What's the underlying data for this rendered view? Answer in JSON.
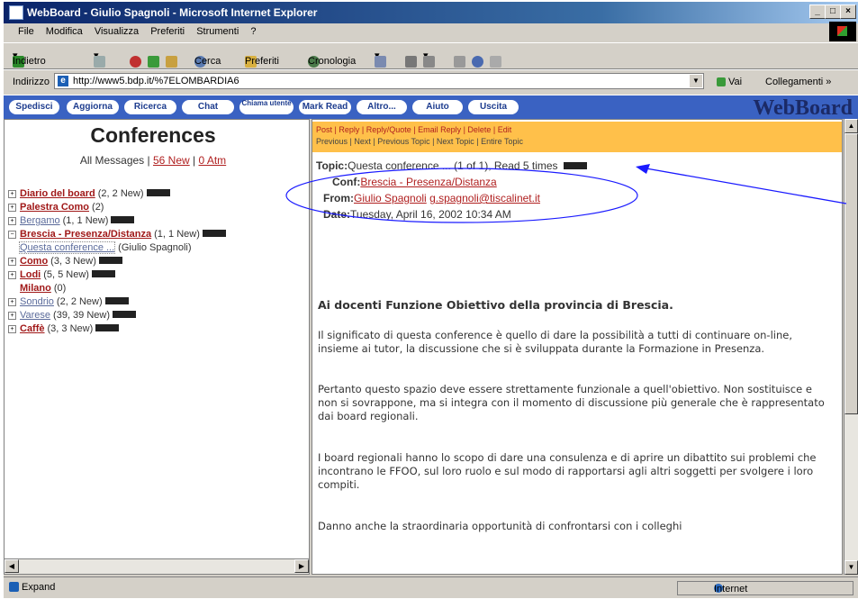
{
  "window": {
    "title": "WebBoard - Giulio Spagnoli - Microsoft Internet Explorer"
  },
  "menu": [
    "File",
    "Modifica",
    "Visualizza",
    "Preferiti",
    "Strumenti",
    "?"
  ],
  "toolbar": {
    "back": "Indietro",
    "search": "Cerca",
    "favorites": "Preferiti",
    "history": "Cronologia"
  },
  "address": {
    "label": "Indirizzo",
    "url": "http://www5.bdp.it/%7ELOMBARDIA6",
    "go": "Vai",
    "links": "Collegamenti"
  },
  "nav": [
    "Spedisci",
    "Aggiorna",
    "Ricerca",
    "Chat",
    "Chiama utente",
    "Mark Read",
    "Altro...",
    "Aiuto",
    "Uscita"
  ],
  "brand": "WebBoard",
  "left": {
    "title": "Conferences",
    "all_messages": "All Messages",
    "sep": "|",
    "new_link": "56 New",
    "atm_link": "0 Atm",
    "items": [
      {
        "name": "Diario del board",
        "counts": "(2, 2 New)",
        "expand": "+",
        "style": "bold",
        "badge": true
      },
      {
        "name": "Palestra Como",
        "counts": "(2)",
        "expand": "+",
        "style": "bold",
        "badge": false
      },
      {
        "name": "Bergamo",
        "counts": "(1, 1 New)",
        "expand": "+",
        "style": "plain",
        "badge": true
      },
      {
        "name": "Brescia - Presenza/Distanza",
        "counts": "(1, 1 New)",
        "expand": "−",
        "style": "bold",
        "badge": true
      },
      {
        "name": "Questa conference ...",
        "counts": "(Giulio Spagnoli)",
        "expand": "",
        "style": "sub",
        "badge": false
      },
      {
        "name": "Como",
        "counts": "(3, 3 New)",
        "expand": "+",
        "style": "bold",
        "badge": true
      },
      {
        "name": "Lodi",
        "counts": "(5, 5 New)",
        "expand": "+",
        "style": "bold",
        "badge": true
      },
      {
        "name": "Milano",
        "counts": "(0)",
        "expand": "",
        "style": "bold",
        "badge": false
      },
      {
        "name": "Sondrio",
        "counts": "(2, 2 New)",
        "expand": "+",
        "style": "plain",
        "badge": true
      },
      {
        "name": "Varese",
        "counts": "(39, 39 New)",
        "expand": "+",
        "style": "plain",
        "badge": true
      },
      {
        "name": "Caffè",
        "counts": "(3, 3 New)",
        "expand": "+",
        "style": "bold",
        "badge": true
      }
    ]
  },
  "actions": {
    "line1": "Post | Reply | Reply/Quote | Email Reply | Delete | Edit",
    "line2": "Previous | Next | Previous Topic | Next Topic | Entire Topic"
  },
  "message": {
    "topic_label": "Topic:",
    "topic": "Questa conference ... (1 of 1), Read 5 times",
    "conf_label": "Conf:",
    "conf": "Brescia - Presenza/Distanza",
    "from_label": "From:",
    "from_name": "Giulio Spagnoli",
    "from_email": "g.spagnoli@tiscalinet.it",
    "date_label": "Date:",
    "date": "Tuesday, April 16, 2002 10:34 AM",
    "title": "Ai docenti Funzione Obiettivo della provincia di Brescia.",
    "p1": "Il significato di questa conference è quello di dare la possibilità a tutti di continuare on-line, insieme ai tutor, la discussione che si è sviluppata durante la Formazione in Presenza.",
    "p2": "Pertanto questo spazio deve essere strettamente funzionale a quell'obiettivo. Non sostituisce e non si sovrappone, ma si integra con il momento di discussione più generale che è rappresentato dai board regionali.",
    "p3": "I board regionali hanno lo scopo di dare una consulenza e di aprire un dibattito sui problemi che incontrano le FFOO, sul loro ruolo e sul modo di rapportarsi agli altri soggetti per svolgere i loro compiti.",
    "p4": "Danno anche la straordinaria opportunità di confrontarsi con i colleghi"
  },
  "status": {
    "left": "Expand",
    "zone": "Internet"
  },
  "colors": {
    "nav_bg": "#3a62c2",
    "action_bar": "#ffc04a",
    "link_red": "#b02020",
    "annotation": "#1a1aff"
  }
}
